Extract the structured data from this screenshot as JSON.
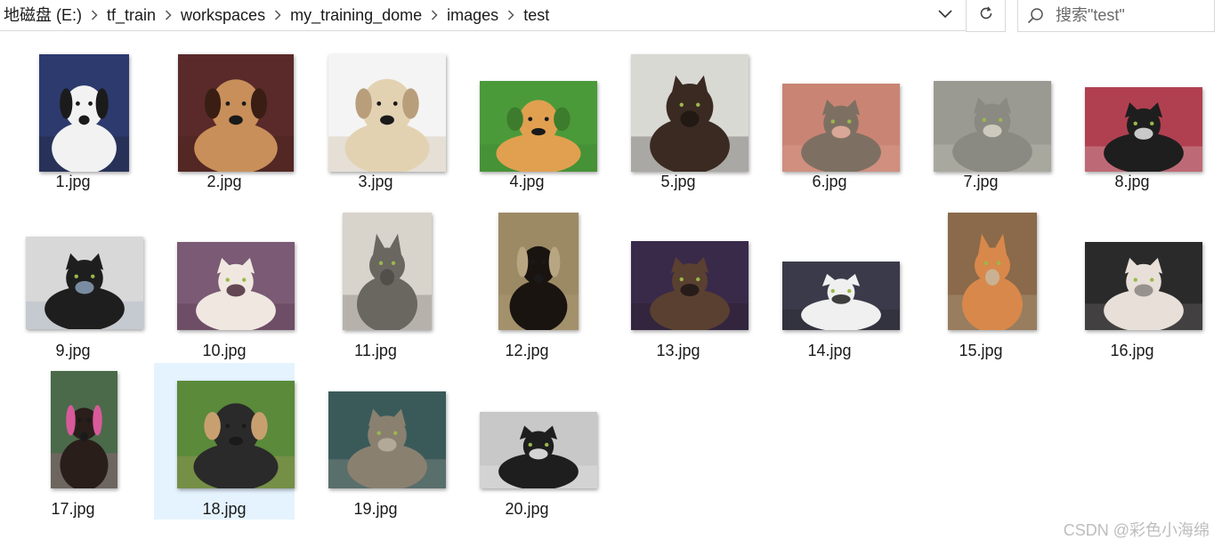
{
  "breadcrumb": [
    {
      "label": "地磁盘 (E:)"
    },
    {
      "label": "tf_train"
    },
    {
      "label": "workspaces"
    },
    {
      "label": "my_training_dome"
    },
    {
      "label": "images"
    },
    {
      "label": "test"
    }
  ],
  "search": {
    "placeholder": "搜索\"test\""
  },
  "icons": {
    "separator": "chevron-right-icon",
    "history": "chevron-down-icon",
    "refresh": "refresh-icon",
    "search": "search-icon"
  },
  "files": [
    {
      "name": "1.jpg",
      "subject": "dog",
      "colors": [
        "#2c3a6e",
        "#f2f2f2",
        "#1b1b1b"
      ]
    },
    {
      "name": "2.jpg",
      "subject": "dog",
      "colors": [
        "#5a2a2a",
        "#c88f5a",
        "#3a1e14"
      ]
    },
    {
      "name": "3.jpg",
      "subject": "dog",
      "colors": [
        "#f4f4f4",
        "#e3d2b2",
        "#b89e7a"
      ]
    },
    {
      "name": "4.jpg",
      "subject": "dog",
      "colors": [
        "#4a9a3a",
        "#e0a050",
        "#3c7c2c"
      ]
    },
    {
      "name": "5.jpg",
      "subject": "cat",
      "colors": [
        "#d9d9d4",
        "#3a2a22",
        "#1e1612"
      ]
    },
    {
      "name": "6.jpg",
      "subject": "cat",
      "colors": [
        "#c98474",
        "#7d7062",
        "#e8b0a0"
      ]
    },
    {
      "name": "7.jpg",
      "subject": "cat",
      "colors": [
        "#9a9a92",
        "#8a8a82",
        "#d8d4c8"
      ]
    },
    {
      "name": "8.jpg",
      "subject": "cat",
      "colors": [
        "#b04050",
        "#1e1e1e",
        "#e8e8e8"
      ]
    },
    {
      "name": "9.jpg",
      "subject": "cat",
      "colors": [
        "#d8d8d8",
        "#1e1e1e",
        "#8aa0b8"
      ]
    },
    {
      "name": "10.jpg",
      "subject": "cat",
      "colors": [
        "#7a5a74",
        "#f0e8e0",
        "#4a2a3a"
      ]
    },
    {
      "name": "11.jpg",
      "subject": "cat",
      "colors": [
        "#d8d4cc",
        "#6a6660",
        "#4e4a46"
      ]
    },
    {
      "name": "12.jpg",
      "subject": "dog",
      "colors": [
        "#9c8a64",
        "#1a1410",
        "#b8a682"
      ]
    },
    {
      "name": "13.jpg",
      "subject": "cat",
      "colors": [
        "#3a2a4a",
        "#5a4030",
        "#1e1616"
      ]
    },
    {
      "name": "14.jpg",
      "subject": "cat",
      "colors": [
        "#3a3a4a",
        "#f0f0f0",
        "#1e1e1e"
      ]
    },
    {
      "name": "15.jpg",
      "subject": "cat",
      "colors": [
        "#8a6a4a",
        "#d8884a",
        "#c8b8a0"
      ]
    },
    {
      "name": "16.jpg",
      "subject": "cat",
      "colors": [
        "#2a2a2a",
        "#e8e0d8",
        "#8a8482"
      ]
    },
    {
      "name": "17.jpg",
      "subject": "dog",
      "colors": [
        "#4a6a4a",
        "#2a1e1a",
        "#d85a9a"
      ]
    },
    {
      "name": "18.jpg",
      "subject": "dog",
      "colors": [
        "#5a8a3a",
        "#2a2a2a",
        "#c8a070"
      ]
    },
    {
      "name": "19.jpg",
      "subject": "cat",
      "colors": [
        "#3a5a5a",
        "#8a8070",
        "#b8b0a0"
      ]
    },
    {
      "name": "20.jpg",
      "subject": "cat",
      "colors": [
        "#c8c8c8",
        "#1e1e1e",
        "#f4f4f4"
      ]
    }
  ],
  "selected_file": "18.jpg",
  "watermark": "CSDN @彩色小海绵"
}
